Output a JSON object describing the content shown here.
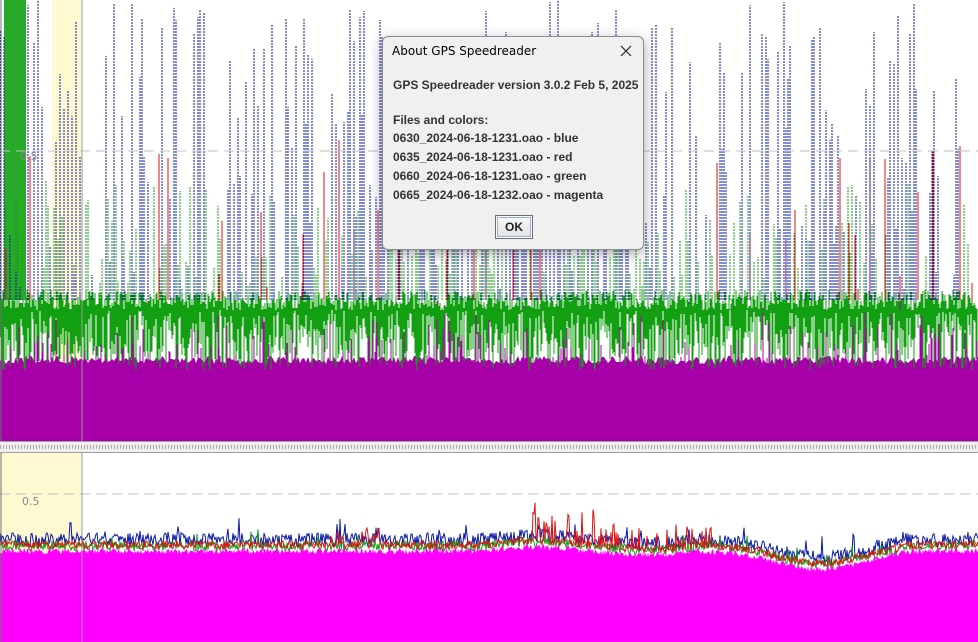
{
  "dialog": {
    "title": "About GPS Speedreader",
    "version": "GPS Speedreader version 3.0.2 Feb 5, 2025",
    "files_heading": "Files and colors:",
    "files": [
      "0630_2024-06-18-1231.oao - blue",
      "0635_2024-06-18-1231.oao - red",
      "0660_2024-06-18-1231.oao - green",
      "0665_2024-06-18-1232.oao - magenta"
    ],
    "ok_label": "OK"
  },
  "charts": {
    "top_reference_label": "0.5",
    "bottom_reference_label": "0.5"
  },
  "colors": {
    "blue": "#0a1aa8",
    "red": "#e01010",
    "green": "#12a012",
    "magenta_top": "#a800a8",
    "magenta_bottom": "#ff00ff",
    "highlight": "#fff9d2",
    "refline": "#c0c0c0"
  }
}
